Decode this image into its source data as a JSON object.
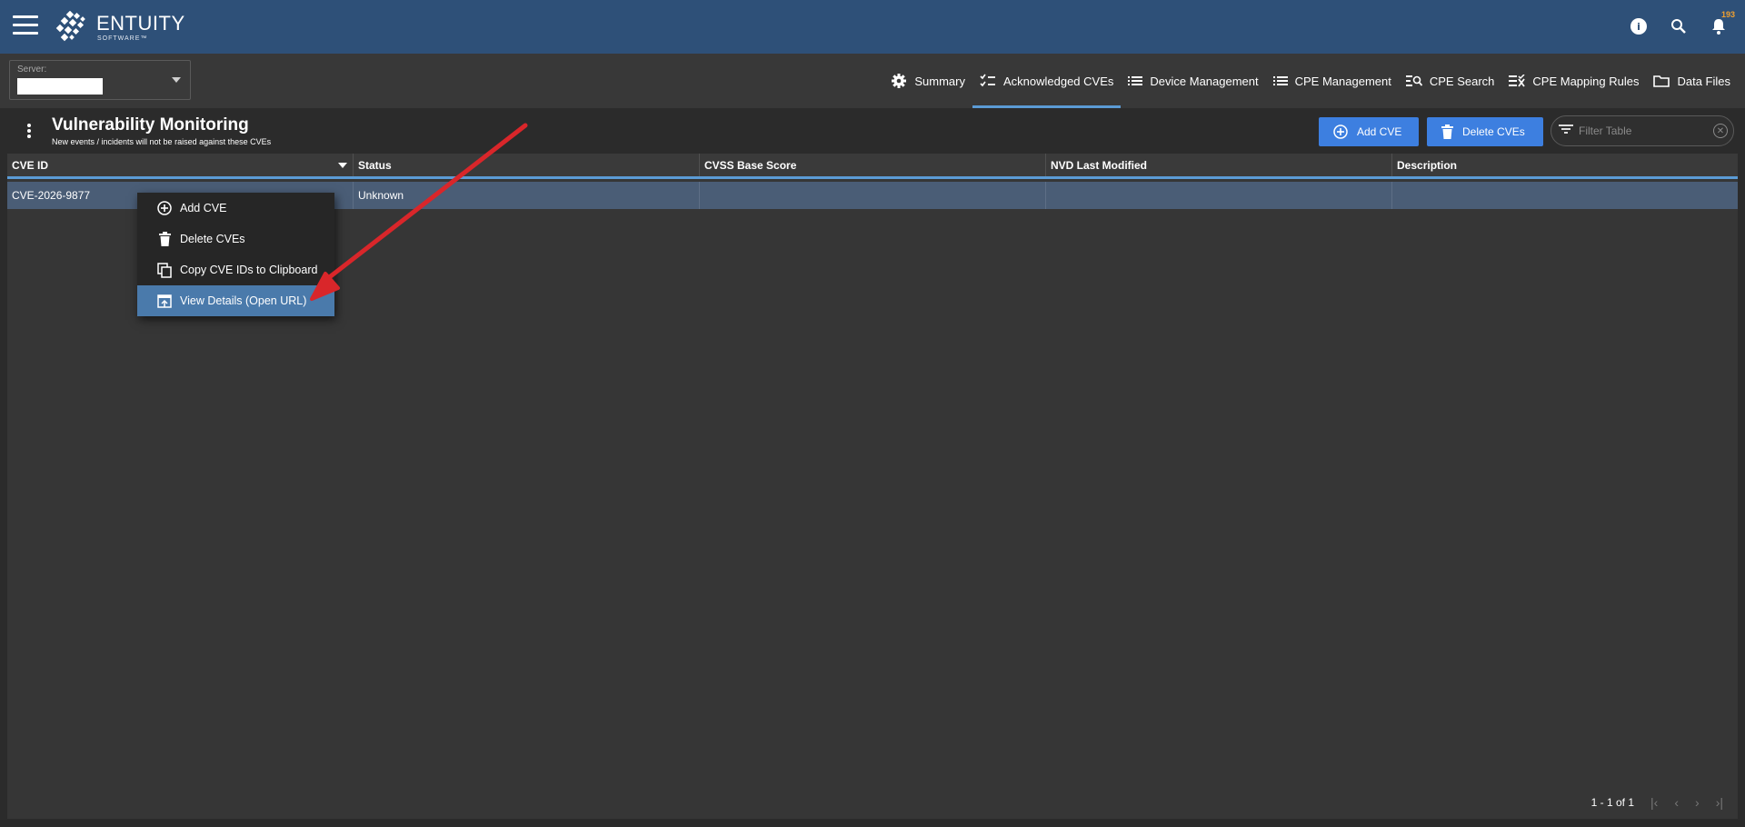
{
  "header": {
    "logo_name": "ENTUITY",
    "logo_sub": "SOFTWARE™",
    "notification_count": "193"
  },
  "server": {
    "label": "Server:",
    "value": ""
  },
  "tabs": [
    {
      "label": "Summary",
      "icon": "gear-icon"
    },
    {
      "label": "Acknowledged CVEs",
      "icon": "checklist-icon",
      "active": true
    },
    {
      "label": "Device Management",
      "icon": "list-icon"
    },
    {
      "label": "CPE Management",
      "icon": "list-icon"
    },
    {
      "label": "CPE Search",
      "icon": "list-search-icon"
    },
    {
      "label": "CPE Mapping Rules",
      "icon": "list-rules-icon"
    },
    {
      "label": "Data Files",
      "icon": "folder-icon"
    }
  ],
  "panel": {
    "title": "Vulnerability Monitoring",
    "subtitle": "New events / incidents will not be raised against these CVEs",
    "add_label": "Add CVE",
    "delete_label": "Delete CVEs",
    "filter_placeholder": "Filter Table"
  },
  "table": {
    "columns": [
      "CVE ID",
      "Status",
      "CVSS Base Score",
      "NVD Last Modified",
      "Description"
    ],
    "rows": [
      {
        "cve_id": "CVE-2026-9877",
        "status": "Unknown",
        "cvss": "",
        "nvd_modified": "",
        "description": ""
      }
    ],
    "pagination": "1 - 1 of 1"
  },
  "context_menu": {
    "items": [
      {
        "label": "Add CVE",
        "icon": "add-circle-icon"
      },
      {
        "label": "Delete CVEs",
        "icon": "trash-icon"
      },
      {
        "label": "Copy CVE IDs to Clipboard",
        "icon": "copy-icon"
      },
      {
        "label": "View Details (Open URL)",
        "icon": "open-in-browser-icon",
        "selected": true
      }
    ]
  },
  "colors": {
    "header_bg": "#2e5078",
    "accent": "#5b9bd5",
    "button": "#3d7fe0",
    "selected_row": "#4a5d76",
    "annotation_arrow": "#d9262a"
  }
}
